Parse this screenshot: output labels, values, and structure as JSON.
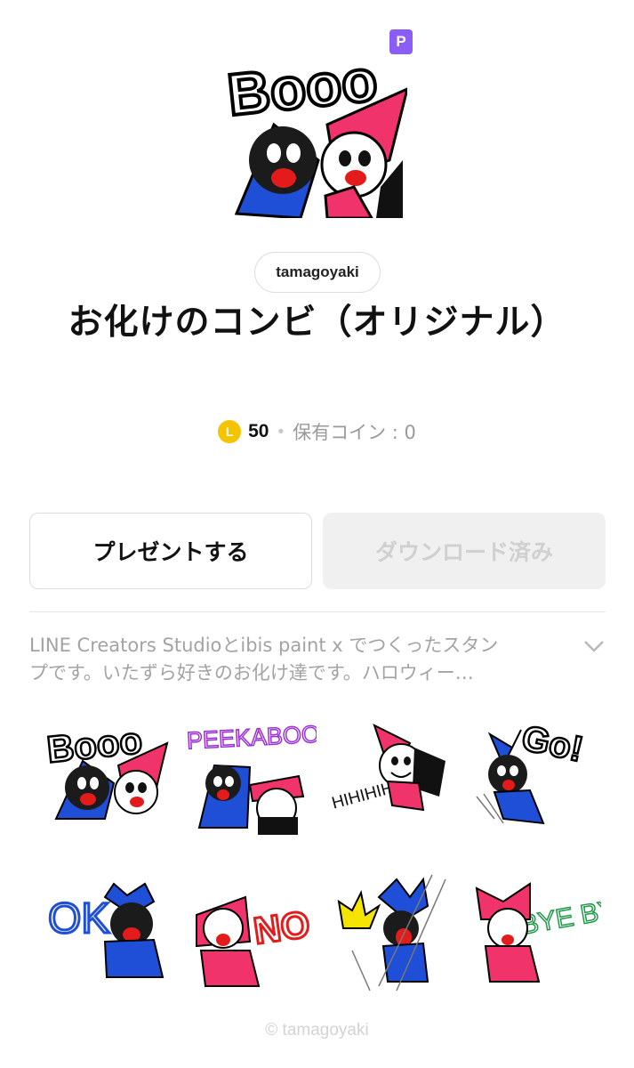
{
  "badge": {
    "label": "P",
    "color": "#8b5cf6"
  },
  "hero": {
    "art_text": "Booo",
    "alt": "main sticker"
  },
  "author": {
    "name": "tamagoyaki"
  },
  "title": "お化けのコンビ（オリジナル）",
  "price": {
    "coin_letter": "L",
    "amount": "50",
    "separator": "•",
    "owned_label": "保有コイン : 0"
  },
  "buttons": {
    "present": "プレゼントする",
    "download": "ダウンロード済み"
  },
  "description": {
    "line1": "LINE Creators Studioとibis paint x でつくったスタン",
    "line2": "プです。いたずら好きのお化け達です。ハロウィー…"
  },
  "stickers": [
    {
      "text": "Booo"
    },
    {
      "text": "PEEKABOO"
    },
    {
      "text": "HIHIHIHI"
    },
    {
      "text": "Go!"
    },
    {
      "text": "OK"
    },
    {
      "text": "NO"
    },
    {
      "text": ""
    },
    {
      "text": "BYE BYE"
    }
  ],
  "copyright": "© tamagoyaki",
  "colors": {
    "blue_ghost": "#1f4fd6",
    "red_ghost": "#f0336a",
    "coin": "#f5c400"
  }
}
